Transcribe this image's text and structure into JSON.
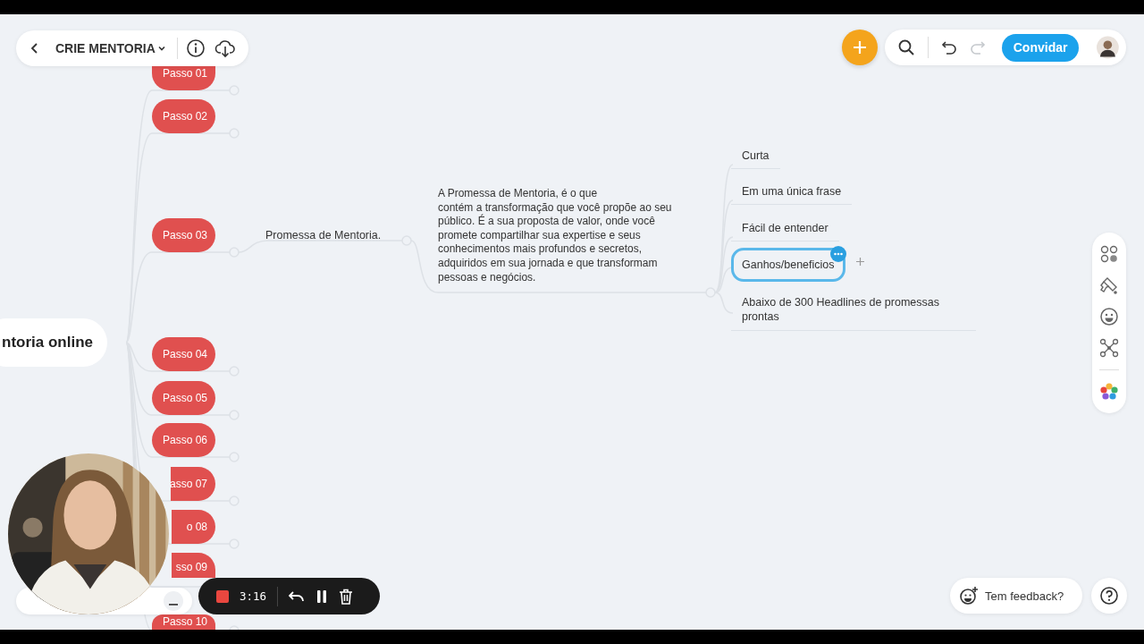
{
  "header": {
    "title": "CRIE MENTORIA"
  },
  "actions": {
    "invite_button": "Convidar",
    "redo_disabled": true
  },
  "mind_map": {
    "root": {
      "label": "ntoria online",
      "children": [
        {
          "label": "Passo 01"
        },
        {
          "label": "Passo 02"
        },
        {
          "label": "Passo 03",
          "children": [
            {
              "label": "Promessa de Mentoria.",
              "children": [
                {
                  "label": "A Promessa de Mentoria, é o que\ncontém a transformação que você propõe ao seu público. É a sua proposta de valor, onde você promete compartilhar sua expertise e seus conhecimentos mais profundos e secretos, adquiridos em sua jornada e que transformam pessoas e negócios.",
                  "children": [
                    {
                      "label": "Curta",
                      "selected": false
                    },
                    {
                      "label": "Em uma única frase",
                      "selected": false
                    },
                    {
                      "label": "Fácil de entender",
                      "selected": false
                    },
                    {
                      "label": "Ganhos/beneficios",
                      "selected": true
                    },
                    {
                      "label": "Abaixo de 300 Headlines de promessas prontas",
                      "selected": false
                    }
                  ]
                }
              ]
            }
          ]
        },
        {
          "label": "Passo 04"
        },
        {
          "label": "Passo 05"
        },
        {
          "label": "Passo 06"
        },
        {
          "label": "asso 07"
        },
        {
          "label": "o 08"
        },
        {
          "label": "sso 09"
        },
        {
          "label": "Passo 10"
        }
      ]
    }
  },
  "recording": {
    "time": "3:16"
  },
  "feedback_button": "Tem feedback?"
}
